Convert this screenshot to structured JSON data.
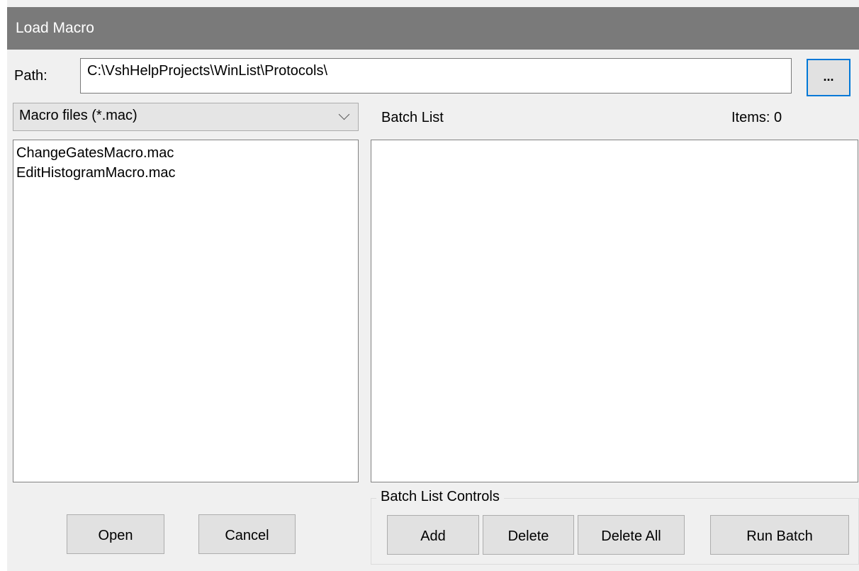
{
  "window": {
    "title": "Load Macro"
  },
  "path": {
    "label": "Path:",
    "value": "C:\\VshHelpProjects\\WinList\\Protocols\\",
    "browse_label": "..."
  },
  "filter": {
    "selected": "Macro files (*.mac)"
  },
  "files": [
    "ChangeGatesMacro.mac",
    "EditHistogramMacro.mac"
  ],
  "batch": {
    "title": "Batch List",
    "items_label": "Items: 0",
    "items": []
  },
  "buttons": {
    "open": "Open",
    "cancel": "Cancel"
  },
  "batch_controls": {
    "title": "Batch List Controls",
    "add": "Add",
    "delete": "Delete",
    "delete_all": "Delete All",
    "run_batch": "Run Batch"
  },
  "colors": {
    "titlebar": "#7a7a7a",
    "dialog_bg": "#f0f0f0",
    "focus_border": "#0078d7"
  }
}
